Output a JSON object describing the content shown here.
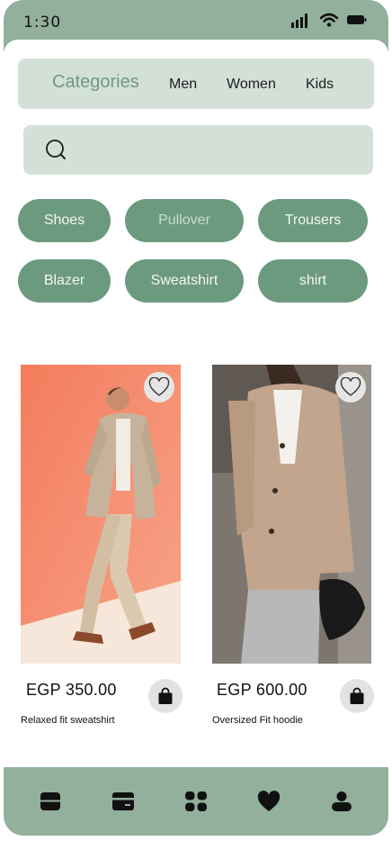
{
  "status": {
    "time": "1:30"
  },
  "categories": {
    "title": "Categories",
    "tabs": [
      "Men",
      "Women",
      "Kids"
    ]
  },
  "search": {
    "placeholder": ""
  },
  "chips": [
    "Shoes",
    "Pullover",
    "Trousers",
    "Blazer",
    "Sweatshirt",
    "shirt"
  ],
  "products": [
    {
      "price": "EGP 350.00",
      "name": "Relaxed fit sweatshirt"
    },
    {
      "price": "EGP 600.00",
      "name": "Oversized Fit hoodie"
    }
  ],
  "colors": {
    "frame": "#92b09c",
    "accent": "#6c9a7e",
    "panel": "#d3e0d8",
    "card1_bg": "#f08a6a",
    "card2_bg": "#8a837c"
  },
  "icons": {
    "status": [
      "signal-icon",
      "wifi-icon",
      "battery-icon"
    ],
    "nav": [
      "home-icon",
      "card-icon",
      "categories-icon",
      "heart-icon",
      "profile-icon"
    ]
  }
}
